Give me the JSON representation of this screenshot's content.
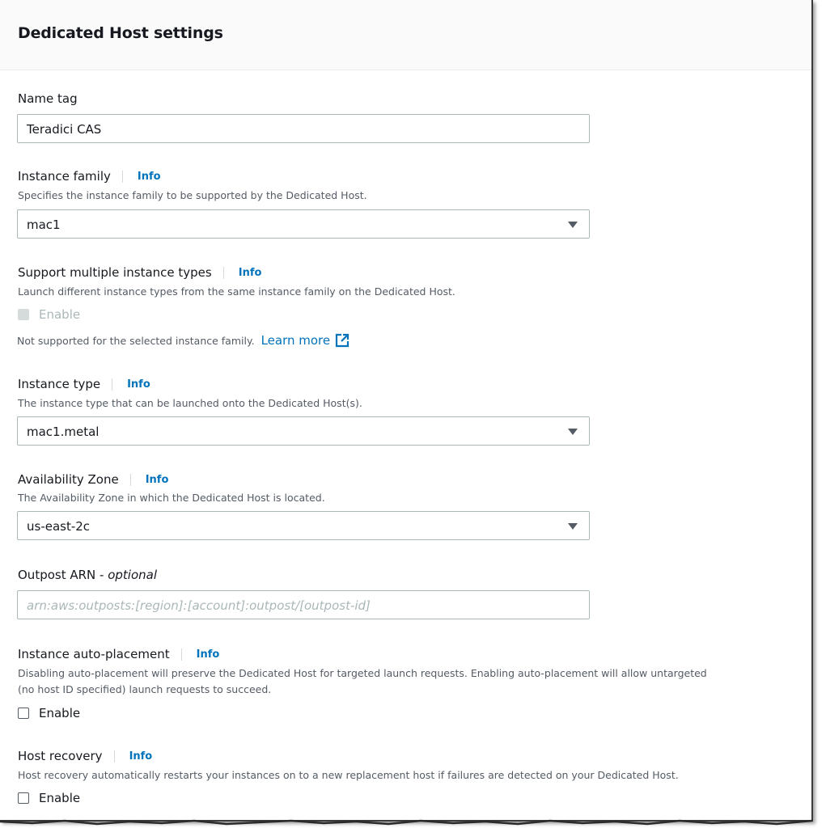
{
  "header": {
    "title": "Dedicated Host settings"
  },
  "name_tag": {
    "label": "Name tag",
    "value": "Teradici CAS"
  },
  "instance_family": {
    "label": "Instance family",
    "info": "Info",
    "description": "Specifies the instance family to be supported by the Dedicated Host.",
    "selected": "mac1"
  },
  "multiple_types": {
    "label": "Support multiple instance types",
    "info": "Info",
    "description": "Launch different instance types from the same instance family on the Dedicated Host.",
    "checkbox_label": "Enable",
    "note": "Not supported for the selected instance family.",
    "learn_more": "Learn more"
  },
  "instance_type": {
    "label": "Instance type",
    "info": "Info",
    "description": "The instance type that can be launched onto the Dedicated Host(s).",
    "selected": "mac1.metal"
  },
  "availability_zone": {
    "label": "Availability Zone",
    "info": "Info",
    "description": "The Availability Zone in which the Dedicated Host is located.",
    "selected": "us-east-2c"
  },
  "outpost_arn": {
    "label": "Outpost ARN - ",
    "label_optional": "optional",
    "placeholder": "arn:aws:outposts:[region]:[account]:outpost/[outpost-id]"
  },
  "auto_placement": {
    "label": "Instance auto-placement",
    "info": "Info",
    "description_line1": "Disabling auto-placement will preserve the Dedicated Host for targeted launch requests. Enabling auto-placement will allow untargeted",
    "description_line2": "(no host ID specified) launch requests to succeed.",
    "checkbox_label": "Enable"
  },
  "host_recovery": {
    "label": "Host recovery",
    "info": "Info",
    "description": "Host recovery automatically restarts your instances on to a new replacement host if failures are detected on your Dedicated Host.",
    "checkbox_label": "Enable"
  },
  "colors": {
    "link": "#0073bb",
    "text": "#16191f",
    "muted": "#545b64",
    "border": "#aab7b8"
  },
  "icons": {
    "dropdown": "caret-down-icon",
    "external": "external-link-icon"
  }
}
